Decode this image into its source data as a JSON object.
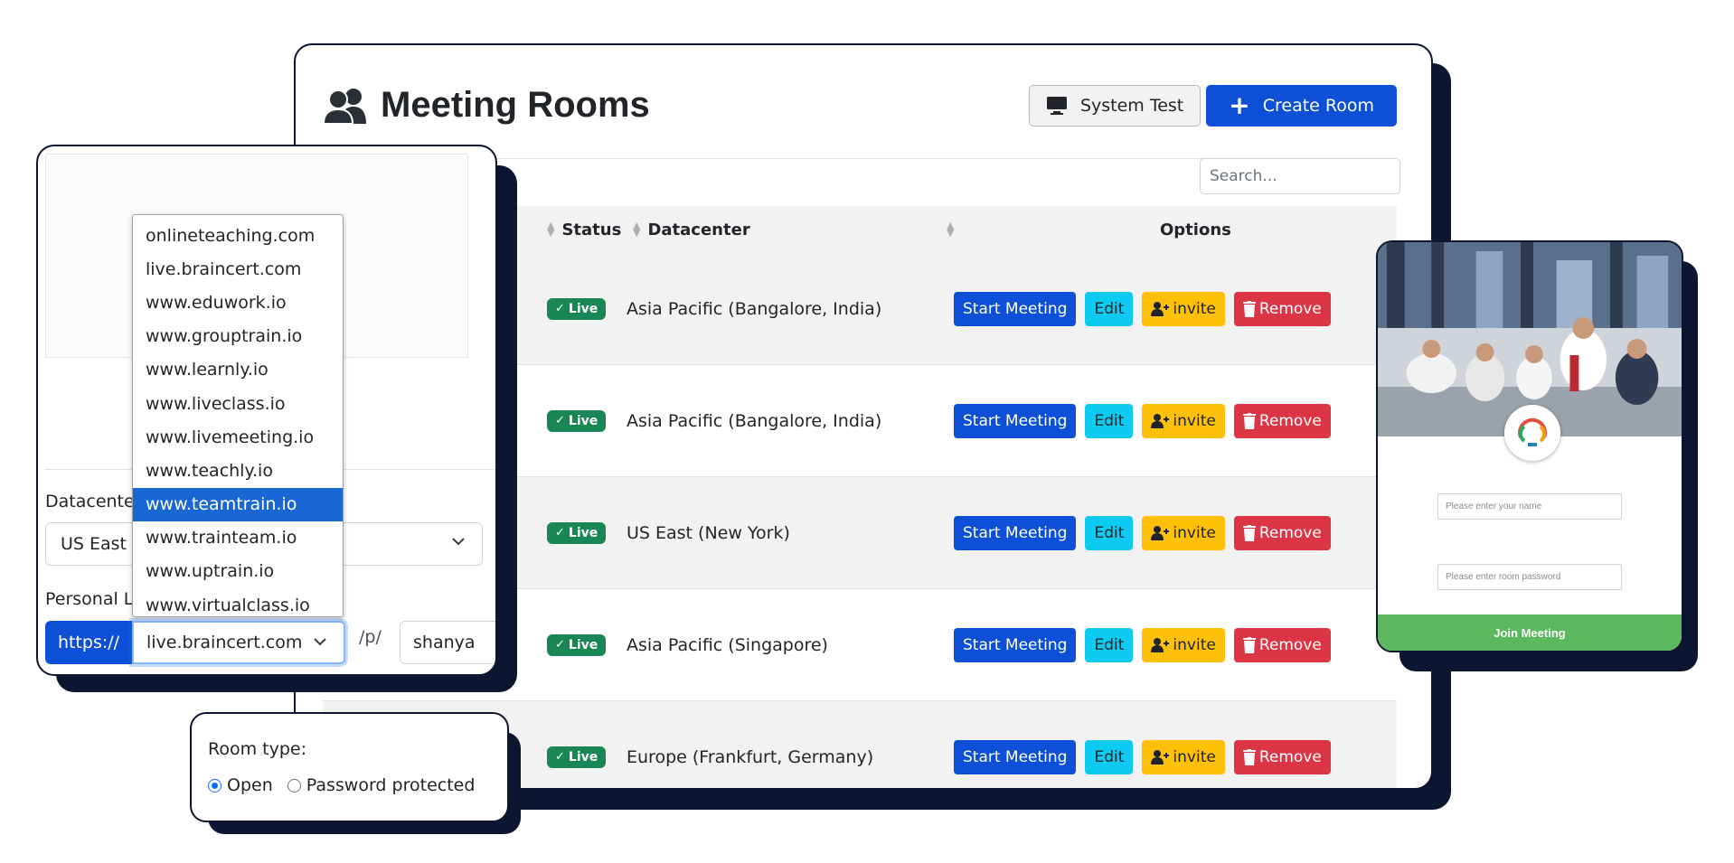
{
  "main": {
    "title": "Meeting Rooms",
    "actions": {
      "system_test": "System Test",
      "create_room": "Create Room"
    },
    "search": {
      "placeholder": "Search..."
    },
    "table": {
      "columns": {
        "status": "Status",
        "datacenter": "Datacenter",
        "options": "Options"
      },
      "rows": [
        {
          "status": "Live",
          "datacenter": "Asia Pacific (Bangalore, India)"
        },
        {
          "status": "Live",
          "datacenter": "Asia Pacific (Bangalore, India)"
        },
        {
          "status": "Live",
          "datacenter": "US East (New York)"
        },
        {
          "status": "Live",
          "datacenter": "Asia Pacific (Singapore)"
        },
        {
          "status": "Live",
          "datacenter": "Europe (Frankfurt, Germany)"
        }
      ],
      "option_labels": {
        "start": "Start Meeting",
        "edit": "Edit",
        "invite": "invite",
        "remove": "Remove"
      }
    }
  },
  "settings": {
    "datacenter_label": "Datacenter",
    "datacenter_value": "US East (",
    "personal_link_label": "Personal Li",
    "protocol": "https://",
    "domain_selected": "live.braincert.com",
    "path_prefix": "/p/",
    "handle": "shanya",
    "domain_options": [
      "onlineteaching.com",
      "live.braincert.com",
      "www.eduwork.io",
      "www.grouptrain.io",
      "www.learnly.io",
      "www.liveclass.io",
      "www.livemeeting.io",
      "www.teachly.io",
      "www.teamtrain.io",
      "www.trainteam.io",
      "www.uptrain.io",
      "www.virtualclass.io"
    ],
    "highlighted_option": "www.teamtrain.io"
  },
  "room_type": {
    "label": "Room type:",
    "options": [
      "Open",
      "Password protected"
    ],
    "selected": "Open"
  },
  "join": {
    "name_placeholder": "Please enter your name",
    "password_placeholder": "Please enter room password",
    "button": "Join Meeting"
  },
  "colors": {
    "primary": "#0d4fd6",
    "success": "#198754",
    "info": "#0dcaf0",
    "warning": "#ffc107",
    "danger": "#dc3545",
    "frame": "#0d1630",
    "join_green": "#5cb85c"
  }
}
